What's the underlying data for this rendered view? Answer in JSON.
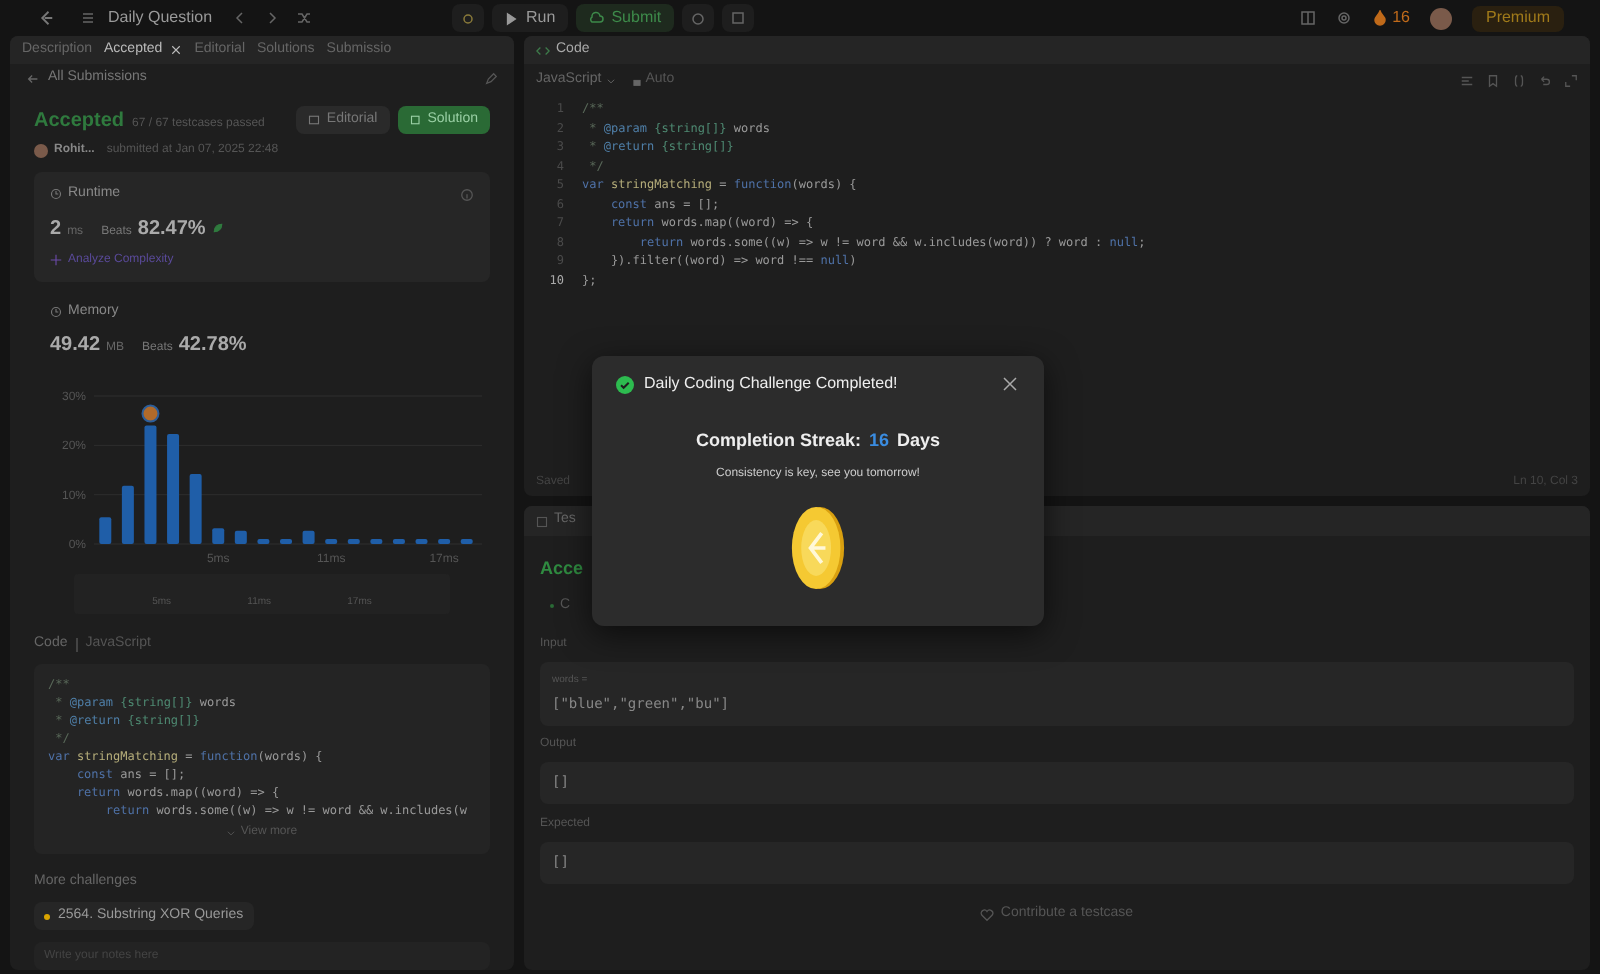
{
  "top_bar": {
    "title": "Daily Question",
    "run": "Run",
    "submit": "Submit",
    "streak": "16",
    "premium": "Premium"
  },
  "left_panel": {
    "tabs": [
      {
        "label": "Description",
        "selected": false
      },
      {
        "label": "Accepted",
        "selected": true
      },
      {
        "label": "Editorial",
        "selected": false
      },
      {
        "label": "Solutions",
        "selected": false
      },
      {
        "label": "Submissio",
        "selected": false
      }
    ],
    "back_link": "All Submissions",
    "submission": {
      "status": "Accepted",
      "passed": "67 / 67 testcases passed",
      "user": "Rohit...",
      "submitted": "submitted at Jan 07, 2025 22:48",
      "buttons": [
        {
          "label": "Editorial",
          "kind": "plain"
        },
        {
          "label": "Solution",
          "kind": "primary"
        }
      ]
    },
    "stats": [
      {
        "title": "Runtime",
        "value": "2",
        "unit": "ms",
        "beats_label": "Beats",
        "beats": "82.47%",
        "link": "Analyze Complexity",
        "selected": true
      },
      {
        "title": "Memory",
        "value": "49.42",
        "unit": "MB",
        "beats_label": "Beats",
        "beats": "42.78%",
        "selected": false
      }
    ],
    "chart_data": {
      "type": "bar",
      "categories": [
        null,
        null,
        null,
        null,
        null,
        "5ms",
        null,
        null,
        null,
        null,
        "11ms",
        null,
        null,
        null,
        null,
        "17ms",
        null
      ],
      "values": [
        5.4,
        11.8,
        24,
        22.3,
        14.2,
        3.2,
        2.7,
        1,
        1,
        2.7,
        1,
        1,
        1,
        1,
        1,
        1,
        1
      ],
      "ylim": [
        0,
        30
      ],
      "yticks": [
        {
          "value": 0,
          "label": "0%"
        },
        {
          "value": 10,
          "label": "10%"
        },
        {
          "value": 20,
          "label": "20%"
        },
        {
          "value": 30,
          "label": "30%"
        }
      ]
    },
    "overview_labels": [
      "5ms",
      "11ms",
      "17ms"
    ],
    "code_section": {
      "title": "Code",
      "language": "JavaScript",
      "view_more": "View more",
      "lines": [
        [
          {
            "kind": "comment",
            "text": "/**"
          }
        ],
        [
          {
            "kind": "comment",
            "text": " * "
          },
          {
            "kind": "tag",
            "text": "@param"
          },
          {
            "kind": "type",
            "text": " {string[]}"
          },
          {
            "kind": "plain",
            "text": " words"
          }
        ],
        [
          {
            "kind": "comment",
            "text": " * "
          },
          {
            "kind": "tag",
            "text": "@return"
          },
          {
            "kind": "type",
            "text": " {string[]}"
          }
        ],
        [
          {
            "kind": "comment",
            "text": " */"
          }
        ],
        [
          {
            "kind": "keyword",
            "text": "var"
          },
          {
            "kind": "name",
            "text": " stringMatching"
          },
          {
            "kind": "plain",
            "text": " = "
          },
          {
            "kind": "keyword",
            "text": "function"
          },
          {
            "kind": "plain",
            "text": "(words) {"
          }
        ],
        [
          {
            "kind": "keyword",
            "text": "    const"
          },
          {
            "kind": "plain",
            "text": " ans = [];"
          }
        ],
        [
          {
            "kind": "keyword",
            "text": "    return"
          },
          {
            "kind": "plain",
            "text": " words.map((word) => {"
          }
        ],
        [
          {
            "kind": "keyword",
            "text": "        return"
          },
          {
            "kind": "plain",
            "text": " words.some((w) => w != word && w.includes(w"
          }
        ]
      ]
    },
    "more_challenges": {
      "title": "More challenges",
      "items": [
        {
          "label": "2564. Substring XOR Queries",
          "color": "#d9a400"
        }
      ]
    },
    "notes": {
      "placeholder": "Write your notes here"
    }
  },
  "right_panel": {
    "code_tab": "Code",
    "language": "JavaScript",
    "mode": "Auto",
    "editor_lines": [
      {
        "number": "1",
        "current": false,
        "tokens": [
          {
            "kind": "comment",
            "text": "/**"
          }
        ]
      },
      {
        "number": "2",
        "current": false,
        "tokens": [
          {
            "kind": "comment",
            "text": " * "
          },
          {
            "kind": "tag",
            "text": "@param"
          },
          {
            "kind": "type",
            "text": " {string[]}"
          },
          {
            "kind": "plain",
            "text": " words"
          }
        ]
      },
      {
        "number": "3",
        "current": false,
        "tokens": [
          {
            "kind": "comment",
            "text": " * "
          },
          {
            "kind": "tag",
            "text": "@return"
          },
          {
            "kind": "type",
            "text": " {string[]}"
          }
        ]
      },
      {
        "number": "4",
        "current": false,
        "tokens": [
          {
            "kind": "comment",
            "text": " */"
          }
        ]
      },
      {
        "number": "5",
        "current": false,
        "tokens": [
          {
            "kind": "keyword",
            "text": "var"
          },
          {
            "kind": "name",
            "text": " stringMatching"
          },
          {
            "kind": "plain",
            "text": " = "
          },
          {
            "kind": "keyword",
            "text": "function"
          },
          {
            "kind": "plain",
            "text": "(words) {"
          }
        ]
      },
      {
        "number": "6",
        "current": false,
        "tokens": [
          {
            "kind": "keyword",
            "text": "    const"
          },
          {
            "kind": "plain",
            "text": " ans = [];"
          }
        ]
      },
      {
        "number": "7",
        "current": false,
        "tokens": [
          {
            "kind": "keyword",
            "text": "    return"
          },
          {
            "kind": "plain",
            "text": " words.map((word) => {"
          }
        ]
      },
      {
        "number": "8",
        "current": false,
        "tokens": [
          {
            "kind": "keyword",
            "text": "        return"
          },
          {
            "kind": "plain",
            "text": " words.some((w) => w != word && w.includes(word)) ? word : "
          },
          {
            "kind": "keyword",
            "text": "null"
          },
          {
            "kind": "plain",
            "text": ";"
          }
        ]
      },
      {
        "number": "9",
        "current": false,
        "tokens": [
          {
            "kind": "plain",
            "text": "    }).filter((word) => word !== "
          },
          {
            "kind": "keyword",
            "text": "null"
          },
          {
            "kind": "plain",
            "text": ")"
          }
        ]
      },
      {
        "number": "10",
        "current": true,
        "tokens": [
          {
            "kind": "plain",
            "text": "};"
          }
        ]
      }
    ],
    "status": "Saved",
    "position": "Ln 10, Col 3",
    "testcase": {
      "tab": "Tes",
      "result": "Acce",
      "case": "C",
      "input_label": "Input",
      "param": "words =",
      "input_value": "[\"blue\",\"green\",\"bu\"]",
      "output_label": "Output",
      "output": "[]",
      "expected_label": "Expected",
      "expected": "[]",
      "contribute": "Contribute a testcase"
    }
  },
  "modal": {
    "title": "Daily Coding Challenge Completed!",
    "streak_label": "Completion Streak:",
    "streak": "16",
    "streak_unit": "Days",
    "message": "Consistency is key, see you tomorrow!"
  }
}
